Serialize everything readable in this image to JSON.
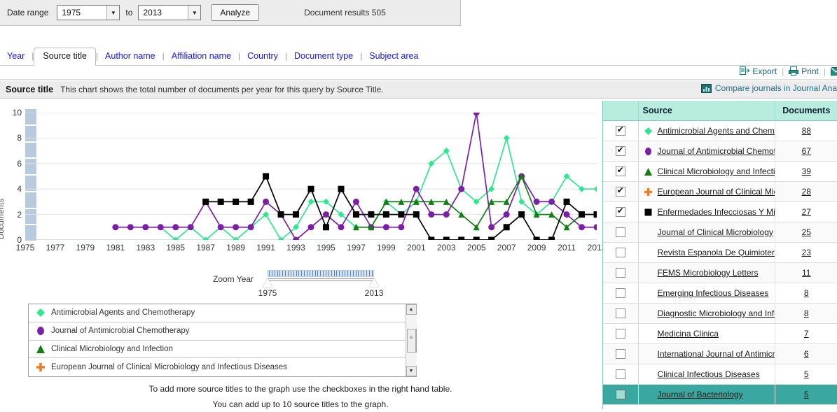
{
  "toolbar": {
    "date_range_label": "Date range",
    "from_year": "1975",
    "to_label": "to",
    "to_year": "2013",
    "analyze_label": "Analyze",
    "document_results": "Document results 505",
    "caret": "▼"
  },
  "tabs": [
    {
      "label": "Year",
      "active": false
    },
    {
      "label": "Source title",
      "active": true
    },
    {
      "label": "Author name",
      "active": false
    },
    {
      "label": "Affiliation name",
      "active": false
    },
    {
      "label": "Country",
      "active": false
    },
    {
      "label": "Document type",
      "active": false
    },
    {
      "label": "Subject area",
      "active": false
    }
  ],
  "actions": {
    "export_label": "Export",
    "print_label": "Print",
    "separator": "|"
  },
  "section": {
    "title": "Source title",
    "description": "This chart shows the total number of documents per year for this query by Source Title.",
    "compare_label": "Compare journals in Journal Ana"
  },
  "zoom_year": {
    "label": "Zoom Year",
    "start": "1975",
    "end": "2013"
  },
  "notes": [
    "To add more source titles to the graph use the checkboxes in the right hand table.",
    "You can add up to 10 source titles to the graph."
  ],
  "legend": [
    {
      "label": "Antimicrobial Agents and Chemotherapy",
      "marker": "diamond",
      "color": "#2ee88f"
    },
    {
      "label": "Journal of Antimicrobial Chemotherapy",
      "marker": "circle",
      "color": "#7b1fa8"
    },
    {
      "label": "Clinical Microbiology and Infection",
      "marker": "triangle",
      "color": "#157d15"
    },
    {
      "label": "European Journal of Clinical Microbiology and Infectious Diseases",
      "marker": "cross",
      "color": "#ef7c1f"
    }
  ],
  "table": {
    "headers": {
      "checkbox": "",
      "source": "Source",
      "documents": "Documents"
    },
    "rows": [
      {
        "checked": true,
        "marker": "diamond",
        "color": "#2ee88f",
        "source": "Antimicrobial Agents and Chemo",
        "documents": "88",
        "highlighted": false
      },
      {
        "checked": true,
        "marker": "circle",
        "color": "#7b1fa8",
        "source": "Journal of Antimicrobial Chemot",
        "documents": "67",
        "highlighted": false
      },
      {
        "checked": true,
        "marker": "triangle",
        "color": "#157d15",
        "source": "Clinical Microbiology and Infectio",
        "documents": "39",
        "highlighted": false
      },
      {
        "checked": true,
        "marker": "cross",
        "color": "#ef7c1f",
        "source": "European Journal of Clinical Mic",
        "documents": "28",
        "highlighted": false
      },
      {
        "checked": true,
        "marker": "square",
        "color": "#000000",
        "source": "Enfermedades Infecciosas Y Mic",
        "documents": "27",
        "highlighted": false
      },
      {
        "checked": false,
        "marker": "none",
        "color": "",
        "source": "Journal of Clinical Microbiology",
        "documents": "25",
        "highlighted": false
      },
      {
        "checked": false,
        "marker": "none",
        "color": "",
        "source": "Revista Espanola De Quimiotera",
        "documents": "23",
        "highlighted": false
      },
      {
        "checked": false,
        "marker": "none",
        "color": "",
        "source": "FEMS Microbiology Letters",
        "documents": "11",
        "highlighted": false
      },
      {
        "checked": false,
        "marker": "none",
        "color": "",
        "source": "Emerging Infectious Diseases",
        "documents": "8",
        "highlighted": false
      },
      {
        "checked": false,
        "marker": "none",
        "color": "",
        "source": "Diagnostic Microbiology and Infe",
        "documents": "8",
        "highlighted": false
      },
      {
        "checked": false,
        "marker": "none",
        "color": "",
        "source": "Medicina Clinica",
        "documents": "7",
        "highlighted": false
      },
      {
        "checked": false,
        "marker": "none",
        "color": "",
        "source": "International Journal of Antimicro",
        "documents": "6",
        "highlighted": false
      },
      {
        "checked": false,
        "marker": "none",
        "color": "",
        "source": "Clinical Infectious Diseases",
        "documents": "5",
        "highlighted": false
      },
      {
        "checked": false,
        "marker": "none",
        "color": "",
        "source": "Journal of Bacteriology",
        "documents": "5",
        "highlighted": true
      }
    ]
  },
  "chart_data": {
    "type": "line",
    "title": "",
    "xlabel": "",
    "ylabel": "Documents",
    "xlim": [
      1975,
      2013
    ],
    "ylim": [
      0,
      10
    ],
    "yticks": [
      0,
      2,
      4,
      6,
      8,
      10
    ],
    "xticks": [
      1975,
      1977,
      1979,
      1981,
      1983,
      1985,
      1987,
      1989,
      1991,
      1993,
      1995,
      1997,
      1999,
      2001,
      2003,
      2005,
      2007,
      2009,
      2011,
      2013
    ],
    "grid": true,
    "legend_position": "below",
    "x": [
      1975,
      1976,
      1977,
      1978,
      1979,
      1980,
      1981,
      1982,
      1983,
      1984,
      1985,
      1986,
      1987,
      1988,
      1989,
      1990,
      1991,
      1992,
      1993,
      1994,
      1995,
      1996,
      1997,
      1998,
      1999,
      2000,
      2001,
      2002,
      2003,
      2004,
      2005,
      2006,
      2007,
      2008,
      2009,
      2010,
      2011,
      2012,
      2013
    ],
    "series": [
      {
        "name": "Antimicrobial Agents and Chemotherapy",
        "marker": "diamond",
        "color": "#2ee88f",
        "values": [
          null,
          null,
          null,
          null,
          null,
          null,
          null,
          null,
          null,
          1,
          0,
          1,
          0,
          1,
          0,
          1,
          2,
          0,
          1,
          3,
          3,
          2,
          1,
          1,
          3,
          2,
          3,
          6,
          7,
          4,
          3,
          4,
          8,
          3,
          2,
          3,
          5,
          4,
          4
        ]
      },
      {
        "name": "Journal of Antimicrobial Chemotherapy",
        "marker": "circle",
        "color": "#7b1fa8",
        "values": [
          null,
          null,
          null,
          null,
          null,
          null,
          1,
          1,
          1,
          1,
          1,
          1,
          3,
          1,
          1,
          1,
          3,
          2,
          0,
          1,
          2,
          1,
          3,
          1,
          1,
          1,
          4,
          2,
          2,
          4,
          10,
          1,
          2,
          5,
          3,
          3,
          2,
          1,
          1
        ]
      },
      {
        "name": "Clinical Microbiology and Infection",
        "marker": "triangle",
        "color": "#157d15",
        "values": [
          null,
          null,
          null,
          null,
          null,
          null,
          null,
          null,
          null,
          null,
          null,
          null,
          null,
          null,
          null,
          null,
          null,
          null,
          null,
          null,
          null,
          null,
          1,
          1,
          3,
          3,
          3,
          3,
          3,
          2,
          1,
          3,
          3,
          5,
          2,
          2,
          1,
          2,
          2
        ]
      },
      {
        "name": "European Journal of Clinical Microbiology and Infectious Diseases",
        "marker": "cross",
        "color": "#ef7c1f",
        "values": [
          null,
          null,
          null,
          null,
          null,
          null,
          null,
          null,
          null,
          null,
          null,
          null,
          null,
          null,
          null,
          null,
          null,
          null,
          null,
          null,
          null,
          null,
          null,
          null,
          null,
          null,
          null,
          null,
          null,
          null,
          null,
          null,
          null,
          null,
          null,
          null,
          null,
          null,
          null
        ]
      },
      {
        "name": "Enfermedades Infecciosas Y Microbiologia Clinica",
        "marker": "square",
        "color": "#000000",
        "values": [
          null,
          null,
          null,
          null,
          null,
          null,
          null,
          null,
          null,
          null,
          null,
          null,
          3,
          3,
          3,
          3,
          5,
          2,
          2,
          4,
          1,
          4,
          2,
          2,
          2,
          2,
          2,
          0,
          0,
          0,
          0,
          0,
          1,
          2,
          0,
          0,
          3,
          2,
          2
        ]
      }
    ]
  }
}
